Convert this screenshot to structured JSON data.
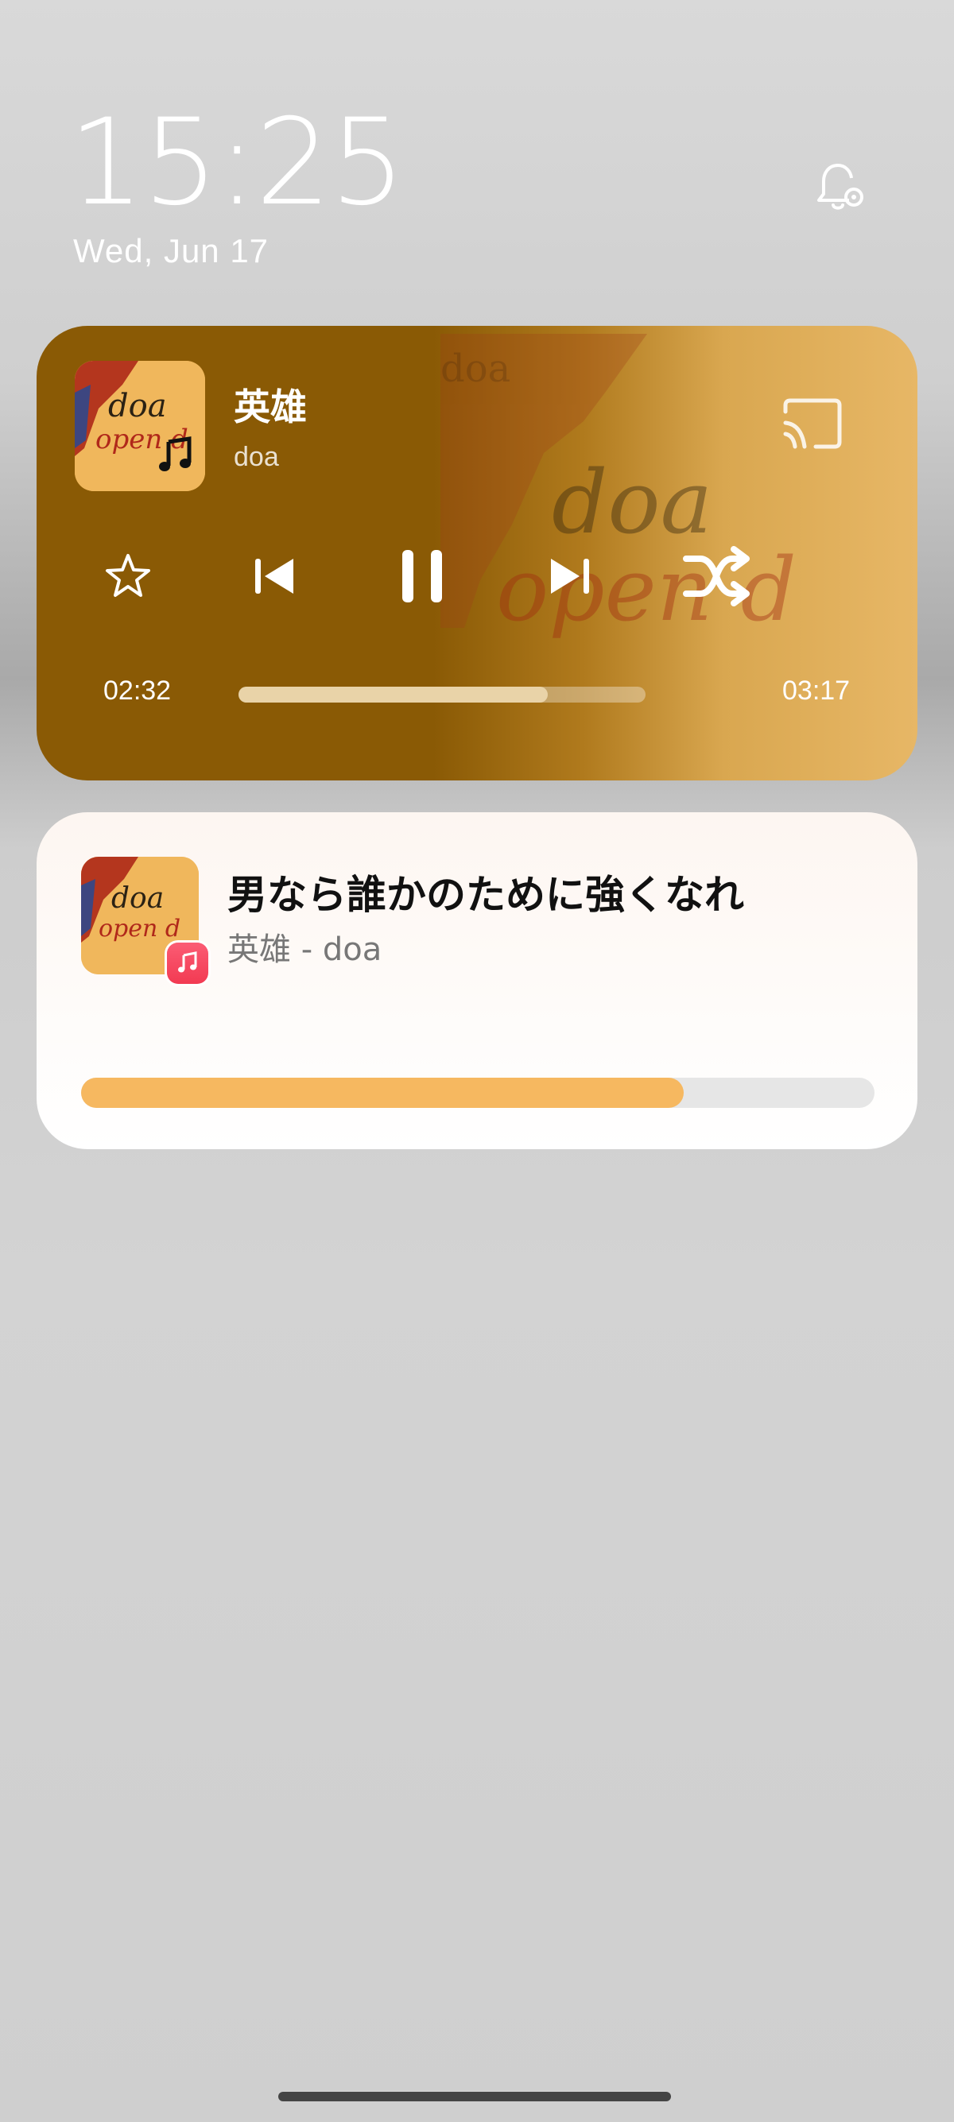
{
  "lockscreen": {
    "time": "15:25",
    "date": "Wed, Jun 17"
  },
  "icons": {
    "notification_settings": "bell-gear-icon",
    "cast": "cast-icon",
    "favorite": "star-icon",
    "previous": "skip-previous-icon",
    "pause": "pause-icon",
    "next": "skip-next-icon",
    "shuffle": "shuffle-icon",
    "music_note": "music-note-icon",
    "music_app": "apple-music-icon"
  },
  "player": {
    "title": "英雄",
    "artist": "doa",
    "elapsed": "02:32",
    "total": "03:17",
    "progress": 0.76,
    "accent_color": "#8a5a05"
  },
  "notification": {
    "title": "男なら誰かのために強くなれ",
    "subtitle": "英雄 - doa",
    "progress": 0.76,
    "progress_color": "#f6b860"
  }
}
